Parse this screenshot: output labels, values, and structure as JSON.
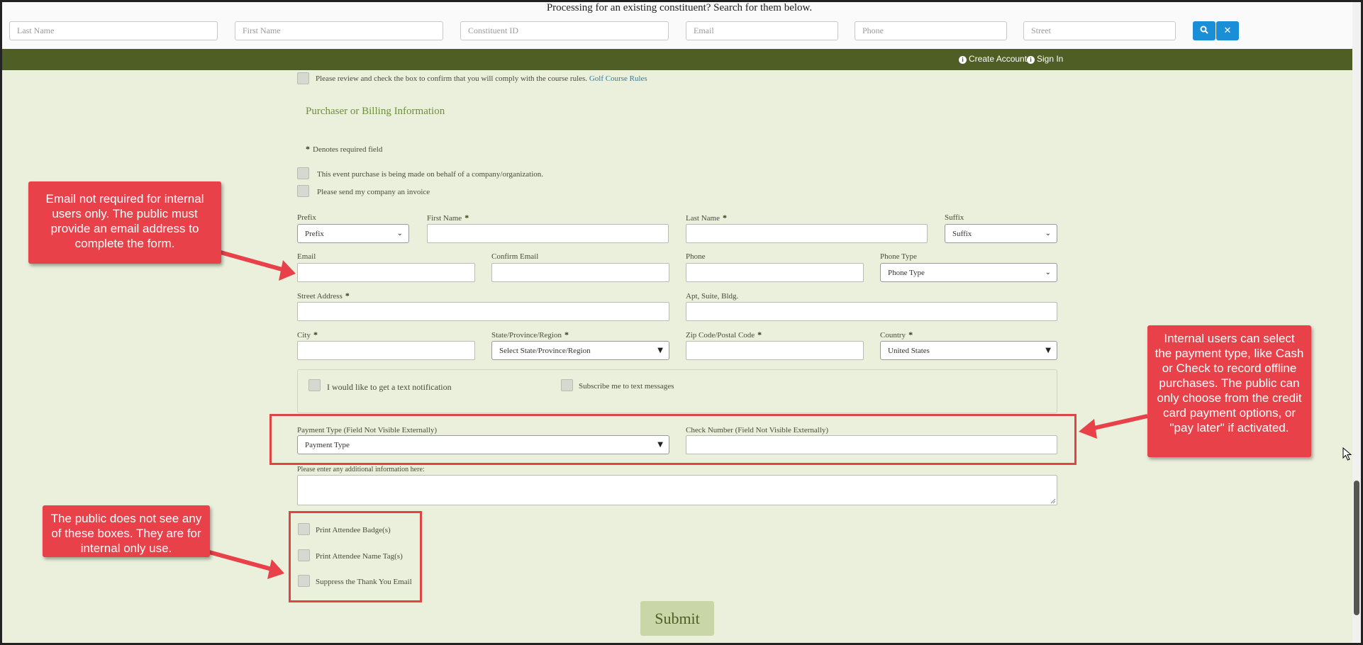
{
  "search": {
    "title": "Processing for an existing constituent? Search for them below.",
    "placeholders": {
      "last_name": "Last Name",
      "first_name": "First Name",
      "constituent_id": "Constituent ID",
      "email": "Email",
      "phone": "Phone",
      "street": "Street"
    },
    "search_icon": "search-icon",
    "clear_icon": "close-icon"
  },
  "nav": {
    "create_account": "Create Account",
    "sign_in": "Sign In",
    "icon": "info-icon"
  },
  "rules": {
    "text": "Please review and check the box to confirm that you will comply with the course rules.",
    "link": "Golf Course Rules"
  },
  "purchaser": {
    "title": "Purchaser or Billing Information",
    "required_mark": "*",
    "required_note": "Denotes required field",
    "company_purchase": "This event purchase is being made on behalf of a company/organization.",
    "send_invoice": "Please send my company an invoice"
  },
  "form": {
    "prefix_label": "Prefix",
    "prefix_value": "Prefix",
    "first_name_label": "First Name",
    "last_name_label": "Last Name",
    "suffix_label": "Suffix",
    "suffix_value": "Suffix",
    "email_label": "Email",
    "confirm_email_label": "Confirm Email",
    "phone_label": "Phone",
    "phone_type_label": "Phone Type",
    "phone_type_value": "Phone Type",
    "street_label": "Street Address",
    "apt_label": "Apt, Suite, Bldg.",
    "city_label": "City",
    "state_label": "State/Province/Region",
    "state_value": "Select State/Province/Region",
    "zip_label": "Zip Code/Postal Code",
    "country_label": "Country",
    "country_value": "United States",
    "text_notification": "I would like to get a text notification",
    "subscribe_text": "Subscribe me to text messages",
    "payment_type_label": "Payment Type (Field Not Visible Externally)",
    "payment_type_value": "Payment Type",
    "check_number_label": "Check Number (Field Not Visible Externally)",
    "additional_info_label": "Please enter any additional information here:",
    "print_badge": "Print Attendee Badge(s)",
    "print_name_tag": "Print Attendee Name Tag(s)",
    "suppress_email": "Suppress the Thank You Email",
    "submit": "Submit"
  },
  "callouts": {
    "email": "Email not required for internal users only. The public must provide an email address to complete the form.",
    "payment": "Internal users can select the payment type, like Cash or Check to record offline purchases. The public can only choose from the credit card payment options, or \"pay later\" if activated.",
    "boxes": "The public does not see any of these boxes. They are for internal only use."
  },
  "colors": {
    "page_bg": "#eaf0dc",
    "nav_bar": "#4f5e25",
    "accent_green": "#6f8f3c",
    "callout_red": "#e8414a",
    "search_blue": "#1a8fd8"
  }
}
